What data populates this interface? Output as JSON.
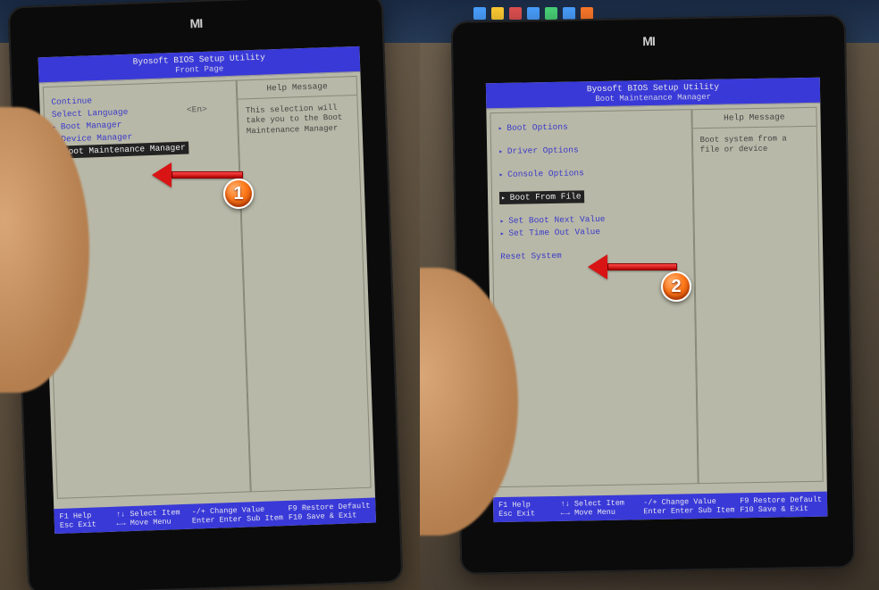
{
  "common": {
    "title": "Byosoft BIOS Setup Utility",
    "help_label": "Help Message",
    "footer": {
      "f1": "F1   Help",
      "esc": "Esc  Exit",
      "sel": "↑↓   Select Item",
      "mov": "←→   Move Menu",
      "chg": "-/+  Change Value",
      "ent": "Enter Enter Sub Item",
      "def": "F9   Restore Default",
      "sav": "F10  Save & Exit"
    }
  },
  "left": {
    "subtitle": "Front Page",
    "items": {
      "continue": "Continue",
      "lang": "Select Language",
      "lang_val": "<En>",
      "boot_mgr": "Boot Manager",
      "dev_mgr": "Device Manager",
      "bmm": "Boot Maintenance Manager"
    },
    "help_text": "This selection will take you to the Boot Maintenance Manager"
  },
  "right": {
    "subtitle": "Boot Maintenance Manager",
    "items": {
      "boot_opt": "Boot Options",
      "drv_opt": "Driver Options",
      "con_opt": "Console Options",
      "boot_file": "Boot From File",
      "set_next": "Set Boot Next Value",
      "set_time": "Set Time Out Value",
      "reset": "Reset System"
    },
    "help_text": "Boot system from a file or device"
  },
  "badges": {
    "one": "1",
    "two": "2"
  }
}
